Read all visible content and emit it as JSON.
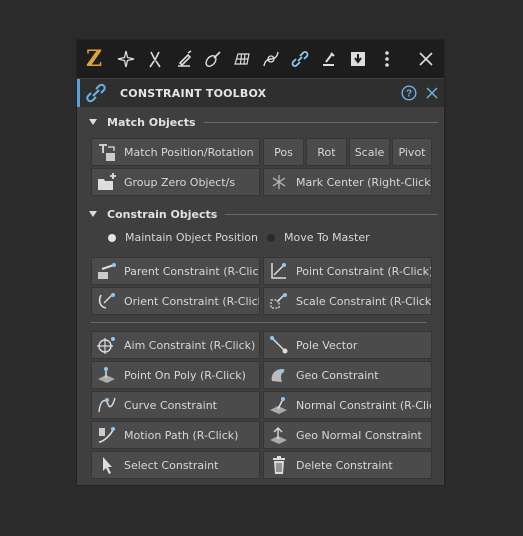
{
  "toolbar": {
    "logo": "Z",
    "icons": [
      "star-icon",
      "tweezers-icon",
      "paint-bucket-icon",
      "brush-icon",
      "grid-icon",
      "curve-icon",
      "link-icon",
      "joint-icon",
      "download-icon",
      "more-icon",
      "close-icon"
    ]
  },
  "title": {
    "text": "CONSTRAINT TOOLBOX",
    "help": "?",
    "accent": "#5aa0d8"
  },
  "match": {
    "header": "Match Objects",
    "match_pos_rot": "Match Position/Rotation",
    "pos": "Pos",
    "rot": "Rot",
    "scale": "Scale",
    "pivot": "Pivot",
    "group_zero": "Group Zero Object/s",
    "mark_center": "Mark Center (Right-Click)"
  },
  "constrain": {
    "header": "Constrain Objects",
    "maintain": "Maintain Object Position",
    "move_to_master": "Move To Master",
    "parent": "Parent Constraint (R-Click)",
    "point": "Point Constraint (R-Click)",
    "orient": "Orient Constraint (R-Click)",
    "scale": "Scale Constraint (R-Click)",
    "aim": "Aim Constraint (R-Click)",
    "pole": "Pole Vector",
    "point_on_poly": "Point On Poly (R-Click)",
    "geo": "Geo Constraint",
    "curve": "Curve Constraint",
    "normal": "Normal Constraint (R-Click)",
    "motion_path": "Motion Path (R-Click)",
    "geo_normal": "Geo Normal Constraint",
    "select": "Select Constraint",
    "delete": "Delete Constraint"
  }
}
